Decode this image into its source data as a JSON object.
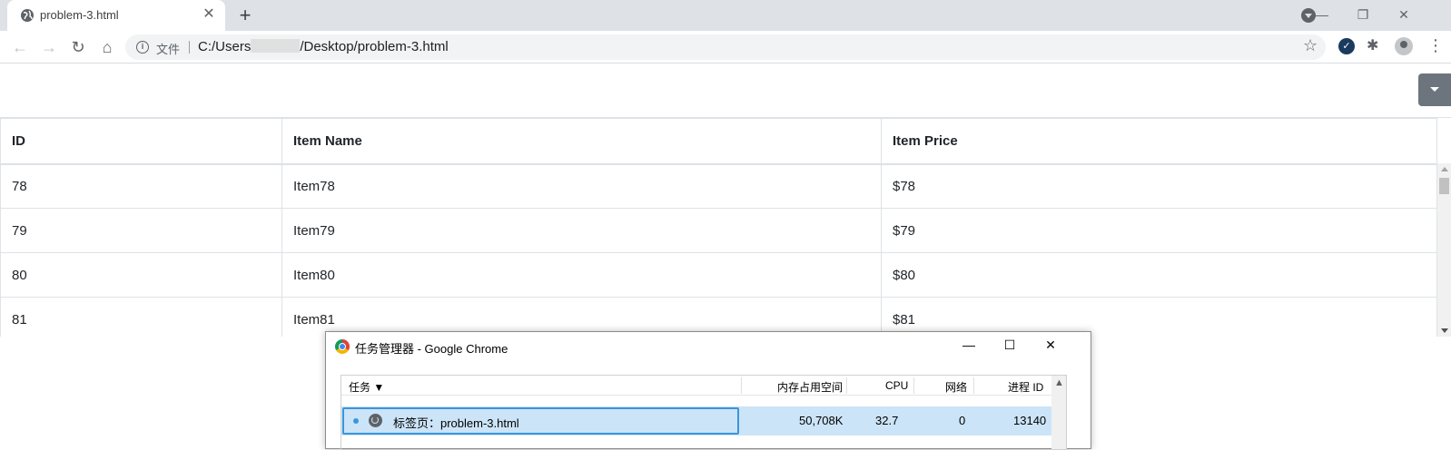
{
  "browser": {
    "tab": {
      "title": "problem-3.html",
      "favicon": "globe-icon",
      "close": "✕"
    },
    "new_tab": "+",
    "window": {
      "minimize": "—",
      "restore": "❐",
      "close": "✕"
    },
    "nav": {
      "back": "←",
      "forward": "→",
      "reload": "↻",
      "home": "⌂"
    },
    "omnibox": {
      "info_icon": "i",
      "site_label": "文件",
      "url_prefix": "C:/Users",
      "url_suffix": "/Desktop/problem-3.html",
      "star": "☆"
    },
    "extensions": {
      "check": "✓",
      "puzzle": "✱"
    },
    "menu": "⋮"
  },
  "table": {
    "headers": [
      "ID",
      "Item Name",
      "Item Price"
    ],
    "rows": [
      [
        "78",
        "Item78",
        "$78"
      ],
      [
        "79",
        "Item79",
        "$79"
      ],
      [
        "80",
        "Item80",
        "$80"
      ],
      [
        "81",
        "Item81",
        "$81"
      ]
    ]
  },
  "task_manager": {
    "title": "任务管理器 - Google Chrome",
    "buttons": {
      "minimize": "—",
      "maximize": "☐",
      "close": "✕"
    },
    "columns": [
      "任务 ▼",
      "内存占用空间",
      "CPU",
      "网络",
      "进程 ID"
    ],
    "selected_row": {
      "task": "标签页：problem-3.html",
      "memory": "50,708K",
      "cpu": "32.7",
      "network": "0",
      "pid": "13140"
    },
    "scroll_up": "▲"
  }
}
